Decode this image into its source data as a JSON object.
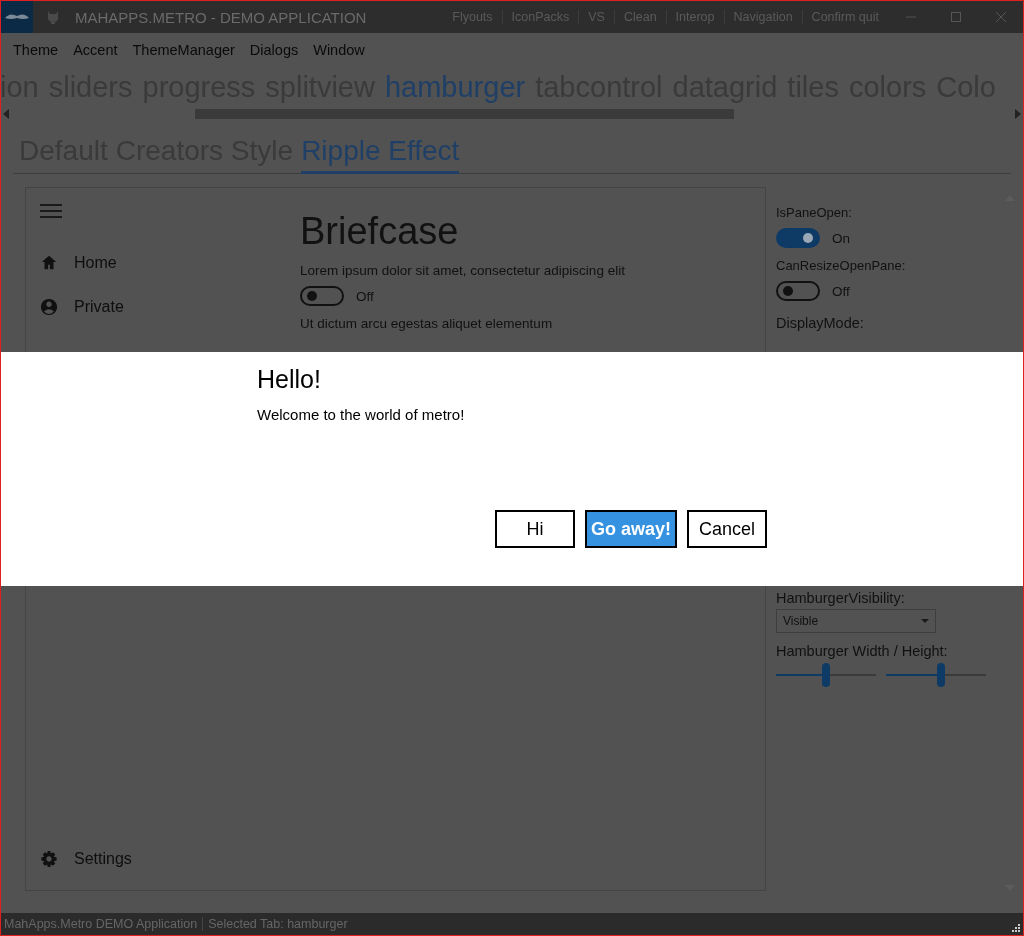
{
  "window": {
    "title": "MAHAPPS.METRO - DEMO APPLICATION",
    "title_commands": [
      "Flyouts",
      "IconPacks",
      "VS",
      "Clean",
      "Interop",
      "Navigation",
      "Confirm quit"
    ]
  },
  "menu": [
    "Theme",
    "Accent",
    "ThemeManager",
    "Dialogs",
    "Window"
  ],
  "main_tabs": [
    {
      "label": "ion",
      "selected": false
    },
    {
      "label": "sliders",
      "selected": false
    },
    {
      "label": "progress",
      "selected": false
    },
    {
      "label": "splitview",
      "selected": false
    },
    {
      "label": "hamburger",
      "selected": true
    },
    {
      "label": "tabcontrol",
      "selected": false
    },
    {
      "label": "datagrid",
      "selected": false
    },
    {
      "label": "tiles",
      "selected": false
    },
    {
      "label": "colors",
      "selected": false
    },
    {
      "label": "Colo",
      "selected": false
    }
  ],
  "sub_tabs": [
    {
      "label": "Default",
      "selected": false
    },
    {
      "label": "Creators Style",
      "selected": false
    },
    {
      "label": "Ripple Effect",
      "selected": true
    }
  ],
  "hamburger": {
    "nav_items": [
      {
        "label": "Home"
      },
      {
        "label": "Private"
      }
    ],
    "footer_items": [
      {
        "label": "Settings"
      }
    ],
    "content": {
      "title": "Briefcase",
      "text": "Lorem ipsum dolor sit amet, consectetur adipiscing elit",
      "toggle": {
        "on": false,
        "label": "Off"
      },
      "text_2": "Ut dictum arcu egestas aliquet elementum"
    }
  },
  "options": {
    "toggles": [
      {
        "label": "IsPaneOpen:",
        "on": true,
        "state_text": "On"
      },
      {
        "label": "CanResizeOpenPane:",
        "on": false,
        "state_text": "Off"
      }
    ],
    "display_mode_label": "DisplayMode:",
    "visibility": {
      "label": "HamburgerVisibility:",
      "value": "Visible"
    },
    "size": {
      "label": "Hamburger Width / Height:",
      "sliders": [
        {
          "level": 0.5
        },
        {
          "level": 0.55
        }
      ]
    }
  },
  "dialog": {
    "title": "Hello!",
    "message": "Welcome to the world of metro!",
    "buttons": [
      {
        "label": "Hi",
        "kind": "default"
      },
      {
        "label": "Go away!",
        "kind": "accent"
      },
      {
        "label": "Cancel",
        "kind": "default"
      }
    ]
  },
  "status_bar": [
    "MahApps.Metro DEMO Application",
    "Selected Tab:  hamburger"
  ]
}
